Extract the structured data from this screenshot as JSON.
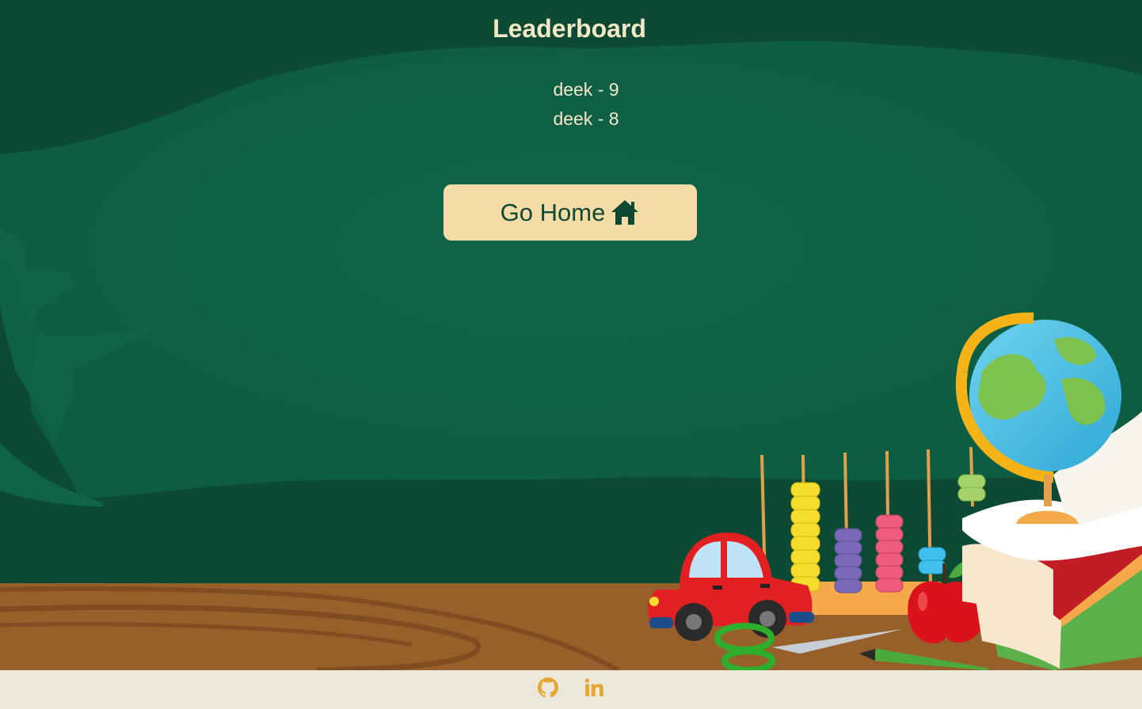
{
  "page": {
    "title": "Leaderboard"
  },
  "leaderboard": {
    "entries": [
      "deek - 9",
      "deek - 8"
    ]
  },
  "actions": {
    "go_home_label": "Go Home",
    "go_home_icon": "home-icon"
  },
  "footer": {
    "links": [
      {
        "icon": "github-icon"
      },
      {
        "icon": "linkedin-icon"
      }
    ]
  },
  "colors": {
    "chalkboard": "#0d5e42",
    "text": "#f3e8c8",
    "button_bg": "#f5dba6",
    "button_text": "#0e4a33",
    "desk": "#97602a",
    "footer_bg": "#ebe9dc",
    "footer_icons": "#e6a830"
  }
}
